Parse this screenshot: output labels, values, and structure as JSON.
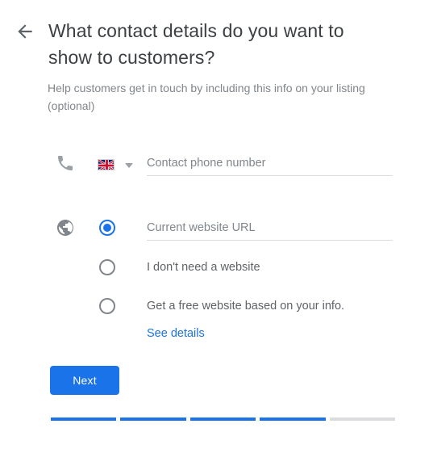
{
  "header": {
    "back_icon": "arrow-left-icon",
    "title": "What contact details do you want to show to customers?",
    "subtitle": "Help customers get in touch by including this info on your listing (optional)"
  },
  "phone": {
    "icon": "phone-icon",
    "country_flag": "united-kingdom-flag",
    "dropdown_icon": "chevron-down-icon",
    "placeholder": "Contact phone number",
    "value": ""
  },
  "website": {
    "icon": "globe-icon",
    "selected_index": 0,
    "options": [
      {
        "label": "",
        "placeholder": "Current website URL",
        "value": "",
        "selected": true,
        "is_input": true
      },
      {
        "label": "I don't need a website",
        "selected": false,
        "is_input": false
      },
      {
        "label": "Get a free website based on your info.",
        "selected": false,
        "is_input": false
      }
    ],
    "see_details_link": "See details"
  },
  "actions": {
    "next_label": "Next"
  },
  "progress": {
    "total_steps": 5,
    "completed_steps": 4,
    "segments": [
      "done",
      "done",
      "done",
      "done",
      "todo"
    ]
  },
  "colors": {
    "accent": "#1a73e8",
    "title_text": "#3c4043",
    "muted_text": "#80868b",
    "body_text": "#5f6368",
    "divider": "#dadce0"
  }
}
